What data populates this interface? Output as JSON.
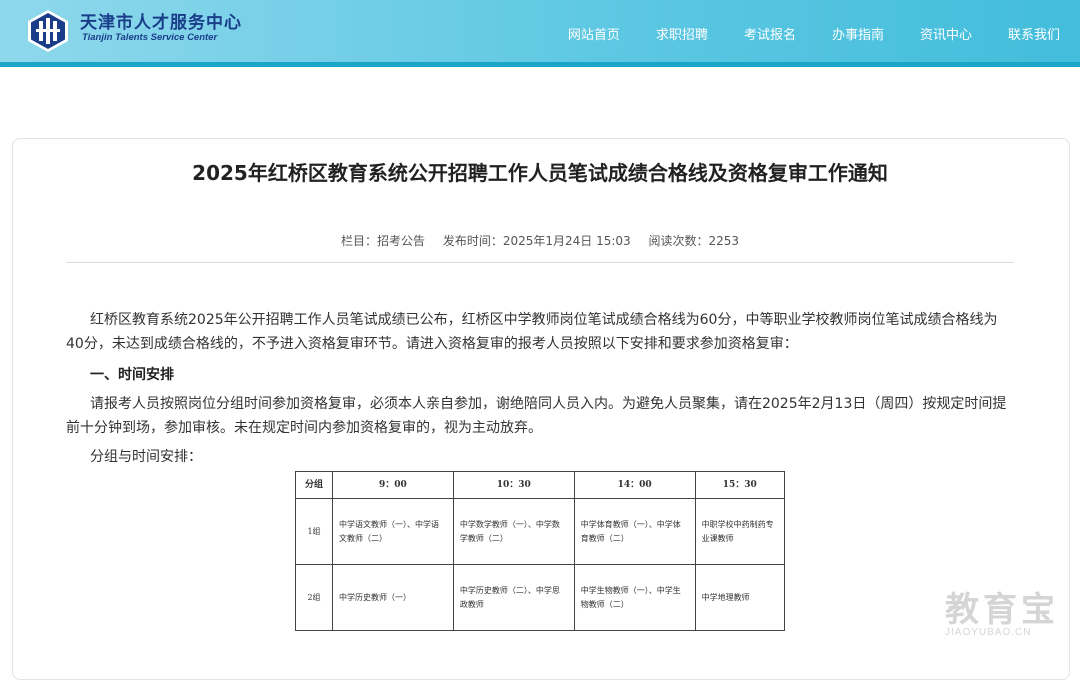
{
  "header": {
    "logo_cn": "天津市人才服务中心",
    "logo_en": "Tianjin Talents Service Center",
    "nav": [
      "网站首页",
      "求职招聘",
      "考试报名",
      "办事指南",
      "资讯中心",
      "联系我们"
    ]
  },
  "article": {
    "title": "2025年红桥区教育系统公开招聘工作人员笔试成绩合格线及资格复审工作通知",
    "meta": {
      "column": "栏目：招考公告",
      "published": "发布时间：2025年1月24日 15:03",
      "views": "阅读次数：2253"
    },
    "para1": "红桥区教育系统2025年公开招聘工作人员笔试成绩已公布，红桥区中学教师岗位笔试成绩合格线为60分，中等职业学校教师岗位笔试成绩合格线为40分，未达到成绩合格线的，不予进入资格复审环节。请进入资格复审的报考人员按照以下安排和要求参加资格复审：",
    "heading1": "一、时间安排",
    "para2": "请报考人员按照岗位分组时间参加资格复审，必须本人亲自参加，谢绝陪同人员入内。为避免人员聚集，请在2025年2月13日（周四）按规定时间提前十分钟到场，参加审核。未在规定时间内参加资格复审的，视为主动放弃。",
    "para3": "分组与时间安排："
  },
  "schedule_table": {
    "headers": [
      "分组",
      "9：00",
      "10：30",
      "14：00",
      "15：30"
    ],
    "rows": [
      {
        "group": "1组",
        "cells": [
          "中学语文教师（一）、中学语文教师（二）",
          "中学数学教师（一）、中学数学教师（二）",
          "中学体育教师（一）、中学体育教师（二）",
          "中职学校中药制药专业课教师"
        ]
      },
      {
        "group": "2组",
        "cells": [
          "中学历史教师（一）",
          "中学历史教师（二）、中学思政教师",
          "中学生物教师（一）、中学生物教师（二）",
          "中学地理教师"
        ]
      }
    ]
  },
  "watermark": {
    "cn": "教育宝",
    "en": "JIAOYUBAO.CN"
  }
}
